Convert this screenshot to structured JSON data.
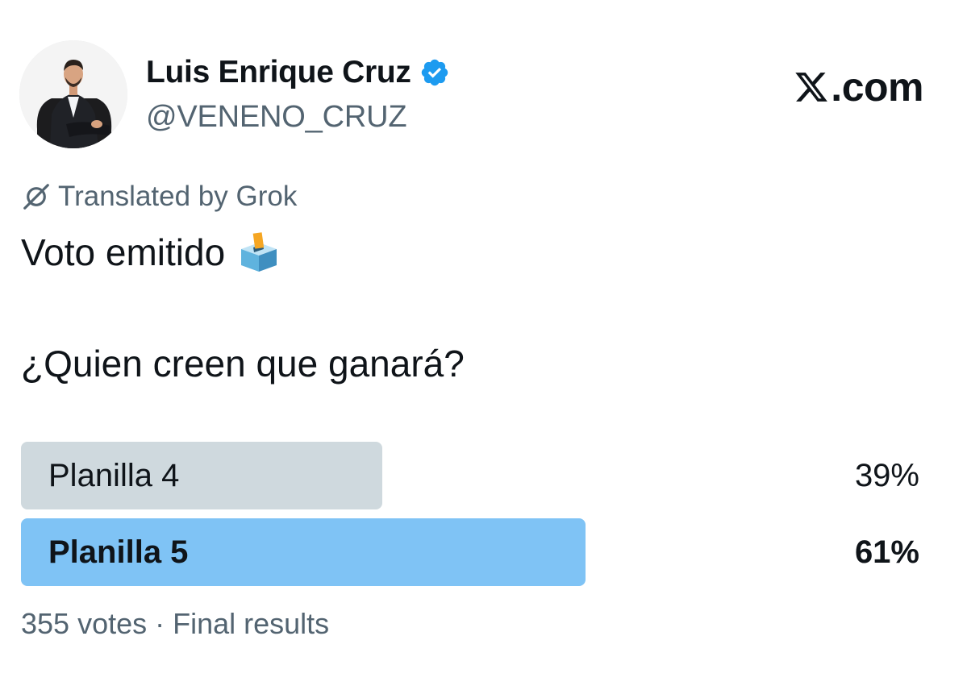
{
  "author": {
    "display_name": "Luis Enrique Cruz",
    "handle": "@VENENO_CRUZ",
    "verified": true,
    "avatar_icon": "profile-photo"
  },
  "brand": {
    "label": ".com",
    "logo_icon": "x-logo-icon"
  },
  "translation": {
    "label": "Translated by Grok",
    "icon": "grok-icon"
  },
  "tweet": {
    "line1": "Voto emitido",
    "emoji": "ballot-box-icon",
    "line2": "¿Quien creen que ganará?"
  },
  "poll": {
    "options": [
      {
        "label": "Planilla 4",
        "percent_text": "39%",
        "percent": 39,
        "winner": false
      },
      {
        "label": "Planilla 5",
        "percent_text": "61%",
        "percent": 61,
        "winner": true
      }
    ],
    "footer": "355 votes · Final results"
  },
  "colors": {
    "verified_badge": "#1d9bf0",
    "winner_bar": "#7fc3f5",
    "loser_bar": "#cfd9de",
    "secondary_text": "#536471",
    "primary_text": "#0f1419"
  }
}
